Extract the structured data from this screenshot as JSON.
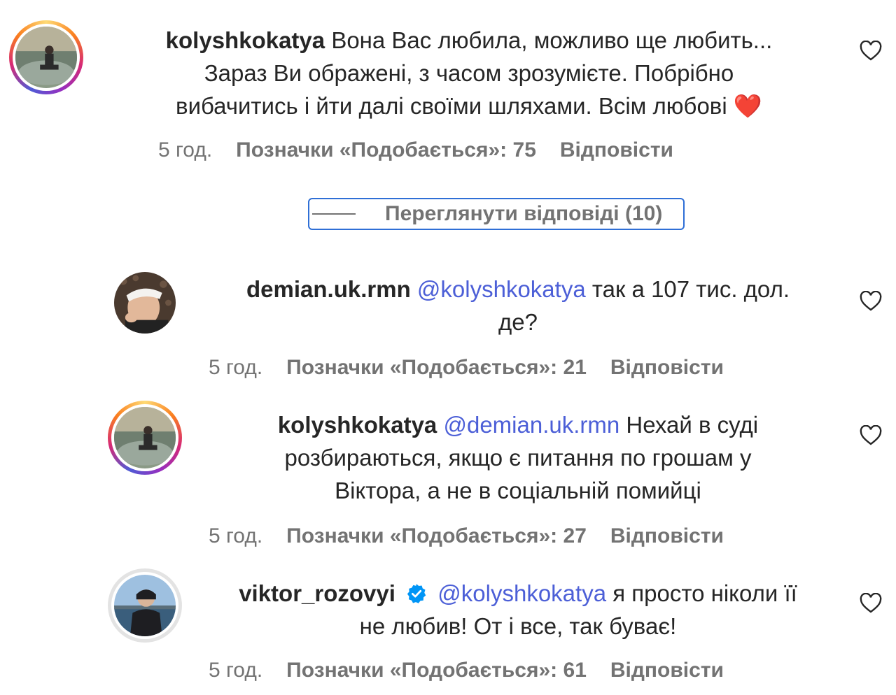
{
  "comments": [
    {
      "username": "kolyshkokatya",
      "text_parts": [
        "Вона Вас любила, можливо ще любить...",
        "Зараз Ви ображені, з часом зрозумієте. Побрібно",
        "вибачитись і йти далі своїми шляхами. Всім любові"
      ],
      "emoji": "❤️",
      "time": "5 год.",
      "likes": "Позначки «Подобається»: 75",
      "reply": "Відповісти",
      "icon": "heart-icon"
    },
    {
      "username": "demian.uk.rmn",
      "mention": "@kolyshkokatya",
      "text_line1": "так а 107 тис. дол.",
      "text_line2": "де?",
      "time": "5 год.",
      "likes": "Позначки «Подобається»: 21",
      "reply": "Відповісти",
      "icon": "heart-icon"
    },
    {
      "username": "kolyshkokatya",
      "mention": "@demian.uk.rmn",
      "text_line1": "Нехай в суді",
      "text_line2": "розбираються, якщо є питання по грошам у",
      "text_line3": "Віктора, а не в соціальній помийці",
      "time": "5 год.",
      "likes": "Позначки «Подобається»: 27",
      "reply": "Відповісти",
      "icon": "heart-icon"
    },
    {
      "username": "viktor_rozovyi",
      "verified": true,
      "mention": "@kolyshkokatya",
      "text_line1": "я просто ніколи її",
      "text_line2": "не любив! От і все, так буває!",
      "time": "5 год.",
      "likes": "Позначки «Подобається»: 61",
      "reply": "Відповісти",
      "icon": "heart-icon"
    }
  ],
  "view_replies": "Переглянути відповіді (10)",
  "colors": {
    "mention": "#4c5fd7",
    "meta": "#737373",
    "text": "#262626",
    "focus_border": "#2f6fd6",
    "verified": "#0095f6"
  }
}
